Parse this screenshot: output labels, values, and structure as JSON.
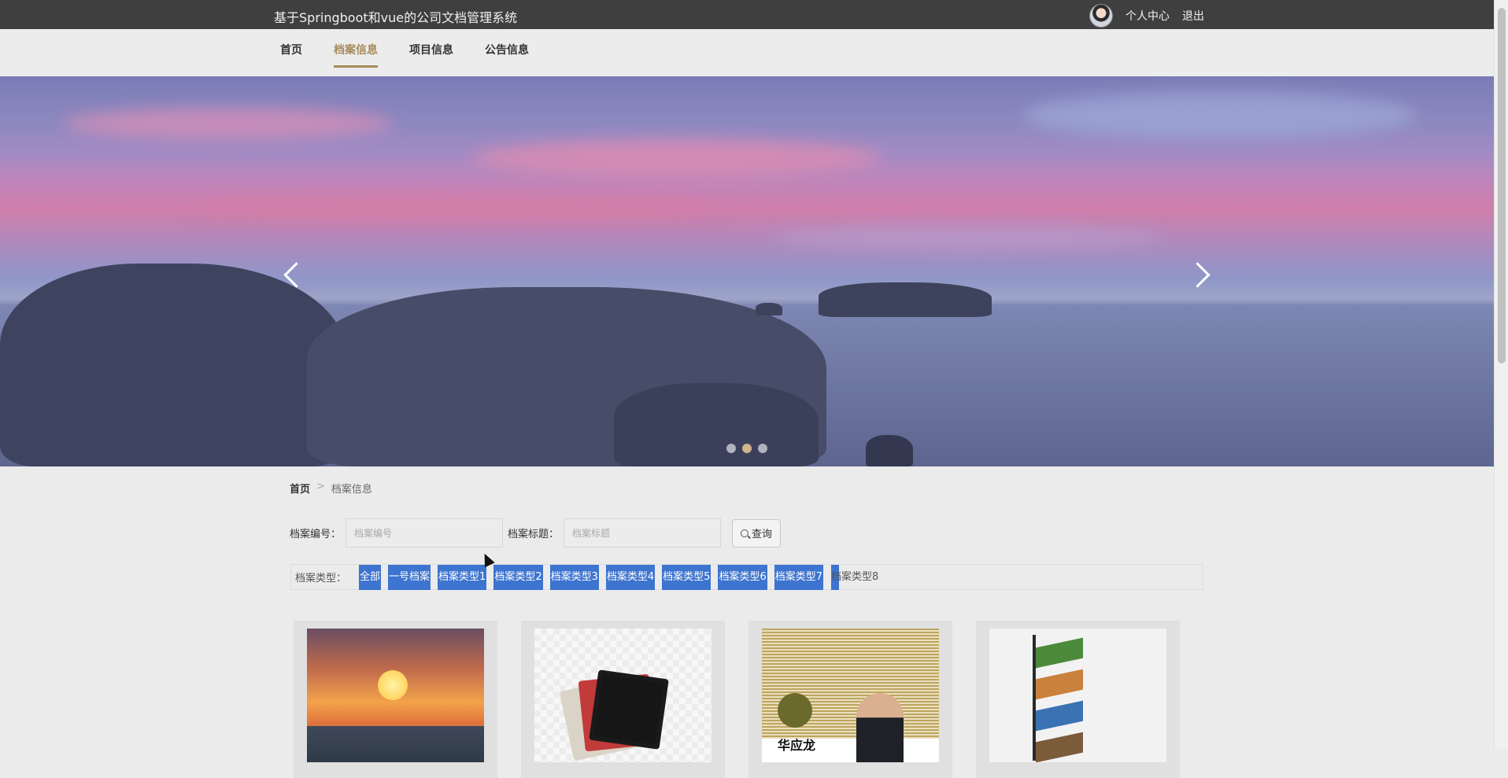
{
  "header": {
    "app_title": "基于Springboot和vue的公司文档管理系统",
    "profile_label": "个人中心",
    "logout_label": "退出",
    "avatar_icon": "user-avatar"
  },
  "nav": {
    "items": [
      {
        "label": "首页"
      },
      {
        "label": "档案信息",
        "active": true
      },
      {
        "label": "项目信息"
      },
      {
        "label": "公告信息"
      }
    ],
    "accent_color": "#a7895a"
  },
  "banner": {
    "prev_icon": "chevron-left-icon",
    "next_icon": "chevron-right-icon",
    "slide_count": 3,
    "active_slide": 2
  },
  "breadcrumb": {
    "home": "首页",
    "separator": ">",
    "current": "档案信息"
  },
  "search": {
    "number_label": "档案编号：",
    "number_placeholder": "档案编号",
    "title_label": "档案标题：",
    "title_placeholder": "档案标题",
    "button_label": "查询"
  },
  "types": {
    "label": "档案类型：",
    "items": [
      "全部",
      "一号档案",
      "档案类型1",
      "档案类型2",
      "档案类型3",
      "档案类型4",
      "档案类型5",
      "档案类型6",
      "档案类型7",
      "档案类型8"
    ],
    "highlight_color": "#3d74cf"
  },
  "cards": [
    {
      "image": "sunset-heart-birds"
    },
    {
      "image": "magazines-tablet"
    },
    {
      "image": "book-cover-portrait",
      "visible_text": "华应龙"
    },
    {
      "image": "magazine-rack"
    }
  ]
}
